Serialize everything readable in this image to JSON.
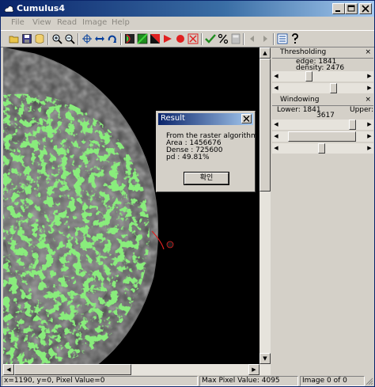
{
  "window": {
    "title": "Cumulus4"
  },
  "menu": [
    "File",
    "View",
    "Read",
    "Image",
    "Help"
  ],
  "toolbar_icons": [
    "open-icon",
    "save-icon",
    "database-icon",
    "zoom-in-icon",
    "zoom-out-icon",
    "crosshair-icon",
    "pan-icon",
    "rotate-icon",
    "skin-line-icon",
    "green-fill-icon",
    "red-fill-icon",
    "red-edge-icon",
    "red-dot-icon",
    "red-cross-icon",
    "check-icon",
    "percent-icon",
    "calculate-icon",
    "prev-icon",
    "next-icon",
    "stats-icon",
    "help-icon"
  ],
  "thresholding": {
    "title": "Thresholding",
    "edge_label": "edge: 1841",
    "density_label": "density: 2476"
  },
  "windowing": {
    "title": "Windowing",
    "lower_label": "Lower: 1841",
    "upper_label": "Upper:",
    "upper_value": "3617"
  },
  "dialog": {
    "title": "Result",
    "line1": "From the raster algorithm:",
    "line2": "Area  : 1456676",
    "line3": "Dense : 725600",
    "line4": "pd    : 49.81%",
    "ok_label": "확인"
  },
  "status": {
    "coords": "x=1190, y=0, Pixel Value=0",
    "max_pixel": "Max Pixel Value: 4095",
    "image_index": "Image 0 of 0"
  },
  "colors": {
    "title_start": "#0a246a",
    "title_end": "#a6caf0",
    "dense_overlay": "#3fd33a",
    "skin_line": "#e02020"
  }
}
